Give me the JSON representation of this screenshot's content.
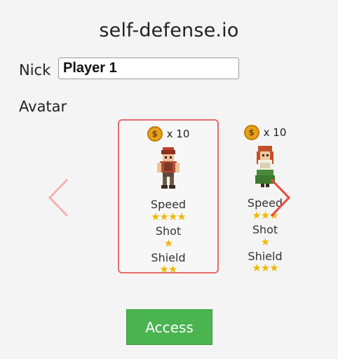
{
  "title": "self-defense.io",
  "nick": {
    "label": "Nick",
    "value": "Player 1"
  },
  "avatar": {
    "label": "Avatar",
    "characters": [
      {
        "price": "x 10",
        "stats": [
          {
            "name": "Speed",
            "stars": "★★★★",
            "rating": 4
          },
          {
            "name": "Shot",
            "stars": "★",
            "rating": 1
          },
          {
            "name": "Shield",
            "stars": "★★",
            "rating": 2
          }
        ],
        "selected": true
      },
      {
        "price": "x 10",
        "stats": [
          {
            "name": "Speed",
            "stars": "★★★",
            "rating": 3
          },
          {
            "name": "Shot",
            "stars": "★",
            "rating": 1
          },
          {
            "name": "Shield",
            "stars": "★★★",
            "rating": 3
          }
        ],
        "selected": false
      }
    ]
  },
  "access_button": "Access",
  "colors": {
    "accent_red": "#e84a3f",
    "button_green": "#4ab450",
    "star_gold": "#f2b700",
    "coin_gold": "#e8a21a"
  },
  "icons": {
    "coin": "$",
    "prev": "chevron-left-icon",
    "next": "chevron-right-icon"
  }
}
